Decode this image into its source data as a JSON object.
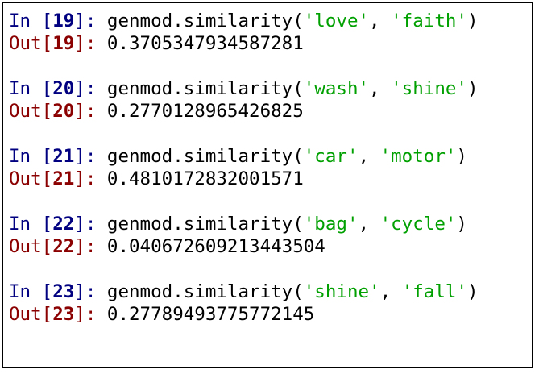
{
  "colors": {
    "in_prompt": "#000080",
    "out_prompt": "#8b0000",
    "string_literal": "#00a000",
    "text": "#000000"
  },
  "prompts": {
    "in_label": "In",
    "out_label": "Out",
    "open": " [",
    "out_open": "[",
    "close": "]: "
  },
  "cells": [
    {
      "n": "19",
      "call": "genmod.similarity(",
      "arg1": "'love'",
      "sep": ", ",
      "arg2": "'faith'",
      "end": ")",
      "output": "0.3705347934587281"
    },
    {
      "n": "20",
      "call": "genmod.similarity(",
      "arg1": "'wash'",
      "sep": ", ",
      "arg2": "'shine'",
      "end": ")",
      "output": "0.2770128965426825"
    },
    {
      "n": "21",
      "call": "genmod.similarity(",
      "arg1": "'car'",
      "sep": ", ",
      "arg2": "'motor'",
      "end": ")",
      "output": "0.4810172832001571"
    },
    {
      "n": "22",
      "call": "genmod.similarity(",
      "arg1": "'bag'",
      "sep": ", ",
      "arg2": "'cycle'",
      "end": ")",
      "output": "0.040672609213443504"
    },
    {
      "n": "23",
      "call": "genmod.similarity(",
      "arg1": "'shine'",
      "sep": ", ",
      "arg2": "'fall'",
      "end": ")",
      "output": "0.27789493775772145"
    }
  ]
}
